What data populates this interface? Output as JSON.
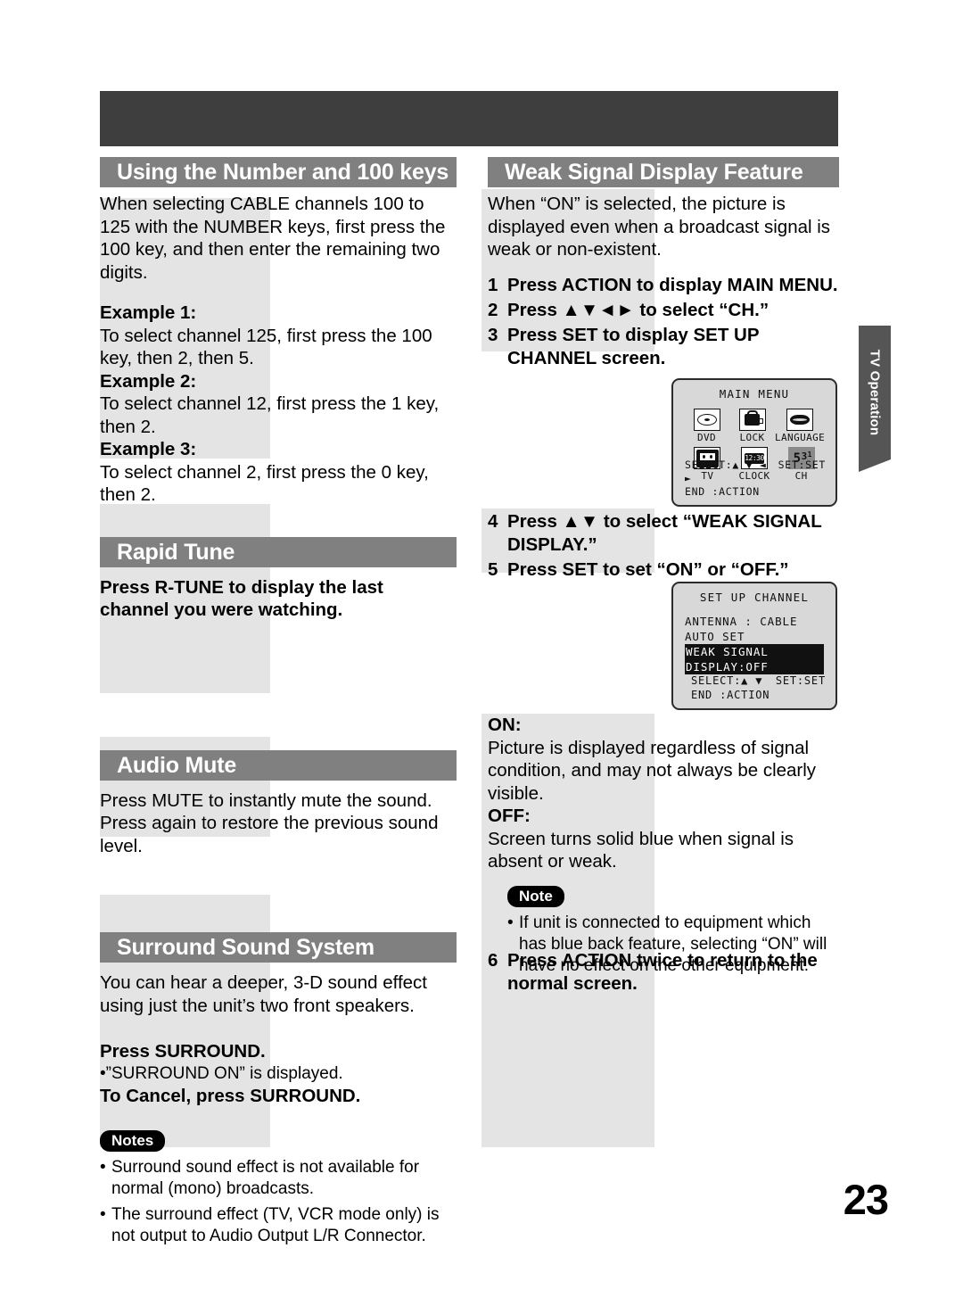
{
  "page_number": "23",
  "side_tab": {
    "label": "TV Operation"
  },
  "left_column": {
    "sections": [
      {
        "id": "number-100-keys",
        "heading": "Using the Number and 100 keys",
        "intro": "When selecting CABLE channels 100 to 125 with the NUMBER keys, first press the 100 key, and then enter the remaining two digits.",
        "examples": [
          {
            "label": "Example 1:",
            "text": "To select channel 125, first press the 100 key, then 2, then 5."
          },
          {
            "label": "Example 2:",
            "text": "To select channel 12, first press the 1 key, then 2."
          },
          {
            "label": "Example 3:",
            "text": "To select channel 2, first press the 0 key, then 2."
          }
        ]
      },
      {
        "id": "rapid-tune",
        "heading": "Rapid Tune",
        "body_bold": "Press R-TUNE to display the last channel you were watching."
      },
      {
        "id": "audio-mute",
        "heading": "Audio Mute",
        "body": "Press MUTE to instantly mute the sound. Press again to restore the previous sound level."
      },
      {
        "id": "surround-sound-system",
        "heading": "Surround Sound System",
        "body": "You can hear a deeper, 3-D sound effect using just the unit’s two front speakers.",
        "press_label": "Press SURROUND.",
        "press_note": "•”SURROUND ON” is displayed.",
        "cancel_label": "To Cancel, press SURROUND.",
        "notes_badge": "Notes",
        "notes": [
          "Surround sound effect is not available for normal (mono) broadcasts.",
          "The surround effect (TV, VCR mode only) is not output to Audio Output L/R Connector."
        ]
      }
    ]
  },
  "right_column": {
    "heading": "Weak Signal Display Feature",
    "intro": "When “ON” is selected, the picture is displayed even when a broadcast signal is weak or non-existent.",
    "steps_1_3": [
      {
        "n": "1",
        "text": "Press ACTION to display MAIN MENU."
      },
      {
        "n": "2",
        "text": "Press ▲▼◄► to select “CH.”"
      },
      {
        "n": "3",
        "text": "Press SET to display SET UP CHANNEL screen."
      }
    ],
    "steps_4_5": [
      {
        "n": "4",
        "text": "Press ▲▼ to select “WEAK SIGNAL DISPLAY.”"
      },
      {
        "n": "5",
        "text": "Press SET to set “ON” or “OFF.”"
      }
    ],
    "on_label": "ON:",
    "on_text": "Picture is displayed regardless of signal condition, and may not always be clearly visible.",
    "off_label": "OFF:",
    "off_text": "Screen turns solid blue when signal is absent or weak.",
    "note_badge": "Note",
    "note_text": "If unit is connected to equipment which has blue back feature, selecting “ON” will have no effect on the other equipment.",
    "step_6": {
      "n": "6",
      "text": "Press ACTION twice to return to the normal screen."
    }
  },
  "osd_main_menu": {
    "title": "MAIN MENU",
    "items": [
      {
        "label": "DVD",
        "icon": "disc-icon",
        "selected": false
      },
      {
        "label": "LOCK",
        "icon": "lock-icon",
        "selected": false
      },
      {
        "label": "LANGUAGE",
        "icon": "lips-icon",
        "selected": false
      },
      {
        "label": "TV",
        "icon": "tv-icon",
        "selected": false
      },
      {
        "label": "CLOCK",
        "icon": "clock-icon",
        "selected": false
      },
      {
        "label": "CH",
        "icon": "channel-icon",
        "selected": true
      }
    ],
    "clock_face": "12:30",
    "ch_digits": {
      "big": "5",
      "mid": "3",
      "small": "1"
    },
    "footer_select": "SELECT:▲ ▼ ◄ ►",
    "footer_set": "SET:SET",
    "footer_end": "END    :ACTION"
  },
  "osd_setup_channel": {
    "title": "SET UP CHANNEL",
    "rows": [
      {
        "text": "ANTENNA : CABLE",
        "highlighted": false
      },
      {
        "text": "AUTO SET",
        "highlighted": false
      },
      {
        "text": "WEAK SIGNAL DISPLAY:OFF",
        "highlighted": true
      }
    ],
    "footer_select": "SELECT:▲ ▼",
    "footer_set": "SET:SET",
    "footer_end": "END    :ACTION"
  },
  "colors": {
    "header_bar": "#808080",
    "top_band": "#3e3e3e",
    "side_tab": "#555555",
    "shade_block": "#e4e4e4",
    "osd_bg": "#d8d8d8"
  }
}
